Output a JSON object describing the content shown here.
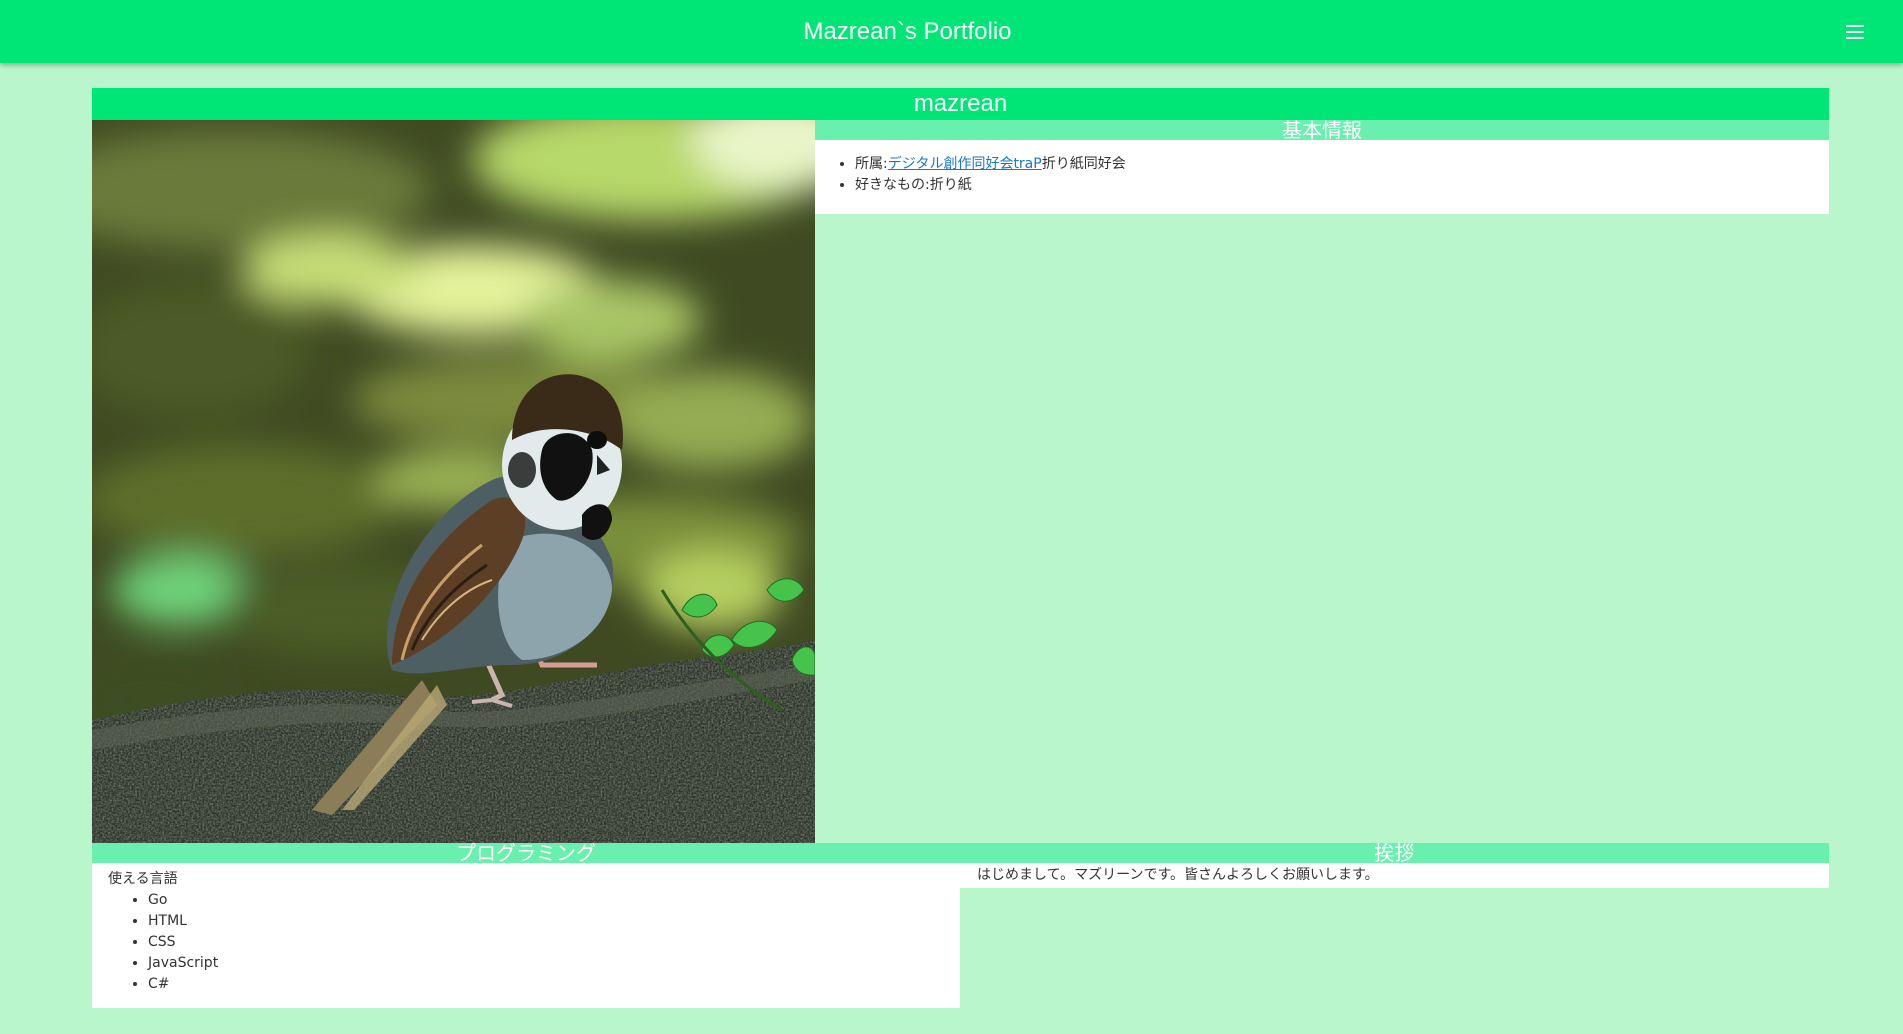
{
  "appbar": {
    "title": "Mazrean`s Portfolio",
    "menu_icon": "hamburger-menu-icon"
  },
  "profile": {
    "name": "mazrean",
    "photo_icon": "sparrow-photo"
  },
  "basic_info": {
    "header": "基本情報",
    "affiliation_label": "所属:",
    "affiliation_link": "デジタル創作同好会traP",
    "affiliation_suffix": "折り紙同好会",
    "likes": "好きなもの:折り紙"
  },
  "programming": {
    "header": "プログラミング",
    "languages_label": "使える言語",
    "languages": [
      "Go",
      "HTML",
      "CSS",
      "JavaScript",
      "C#"
    ]
  },
  "greeting": {
    "header": "挨拶",
    "text": "はじめまして。マズリーンです。皆さんよろしくお願いします。"
  },
  "colors": {
    "appbar": "#00e676",
    "section_header": "#69f0ae",
    "background": "#baf6cb",
    "link": "#1976d2"
  }
}
